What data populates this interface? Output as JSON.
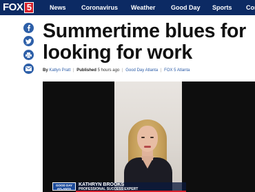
{
  "header": {
    "logo": {
      "brand": "FOX",
      "channel": "5"
    },
    "nav_items": [
      "News",
      "Coronavirus",
      "Weather",
      "Good Day",
      "Sports",
      "Cor"
    ]
  },
  "share_icons": [
    "facebook-icon",
    "twitter-icon",
    "print-icon",
    "email-icon"
  ],
  "article": {
    "headline_lines": [
      "Summertime blues for",
      "looking for work"
    ],
    "byline": {
      "by": "By",
      "author": "Katlyn Pratt",
      "published_label": "Published",
      "time": "5 hours ago",
      "section": "Good Day Atlanta",
      "station": "FOX 5 Atlanta"
    }
  },
  "video": {
    "show_tag_line1": "GOOD DAY",
    "show_tag_line2": "ATLANTA",
    "name": "KATHRYN BROOKS",
    "title": "PROFESSIONAL SUCCESS EXPERT"
  },
  "colors": {
    "nav_bg": "#0c2a63",
    "logo_red": "#d61f2b",
    "share_blue": "#2d5fa8",
    "link_blue": "#2a5ba7"
  }
}
